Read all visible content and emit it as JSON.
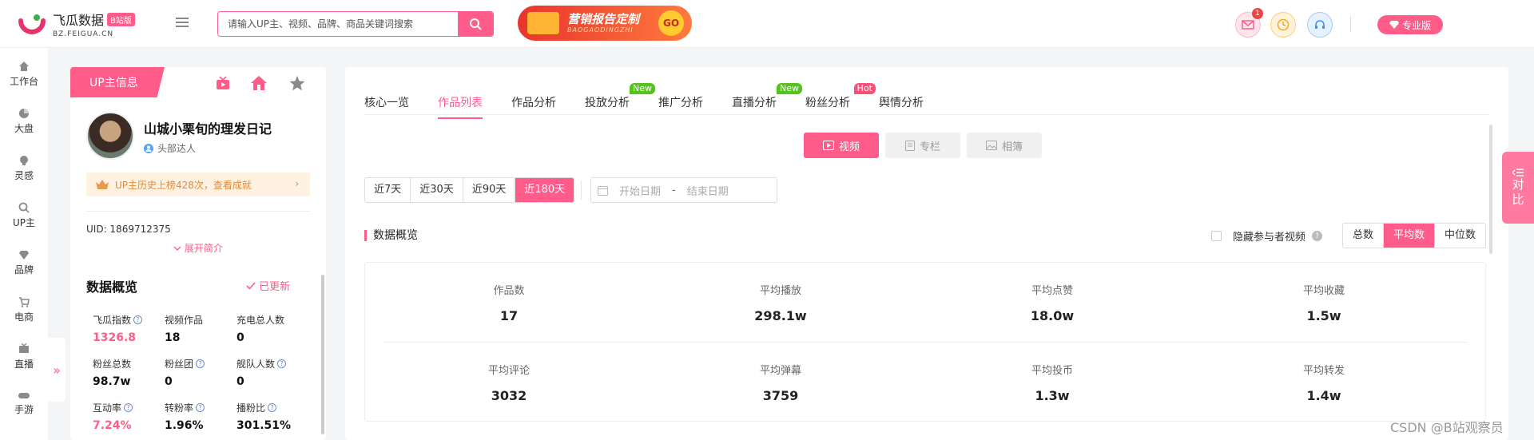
{
  "header": {
    "logo_name": "飞瓜数据",
    "logo_badge": "B站版",
    "logo_domain": "BZ.FEIGUA.CN",
    "search_placeholder": "请输入UP主、视频、品牌、商品关键词搜索",
    "promo_title": "营销报告定制",
    "promo_sub": "BAOGAODINGZHI",
    "promo_go": "GO",
    "message_count": "1",
    "pro_label": "专业版"
  },
  "leftnav": {
    "items": [
      {
        "label": "工作台",
        "icon": "home-icon"
      },
      {
        "label": "大盘",
        "icon": "pie-chart-icon"
      },
      {
        "label": "灵感",
        "icon": "bulb-icon"
      },
      {
        "label": "UP主",
        "icon": "search-icon"
      },
      {
        "label": "品牌",
        "icon": "diamond-icon"
      },
      {
        "label": "电商",
        "icon": "cart-icon"
      },
      {
        "label": "直播",
        "icon": "tv-icon"
      },
      {
        "label": "手游",
        "icon": "gamepad-icon"
      }
    ],
    "collapse": "»"
  },
  "profile": {
    "tab_label": "UP主信息",
    "name": "山城小栗旬的理发日记",
    "tag": "头部达人",
    "history": "UP主历史上榜428次，查看成就",
    "uid": "UID: 1869712375",
    "expand": "展开简介",
    "overview_title": "数据概览",
    "updated": "已更新",
    "stats": [
      {
        "label": "飞瓜指数",
        "value": "1326.8",
        "help": true,
        "pink": true
      },
      {
        "label": "视频作品",
        "value": "18",
        "help": false,
        "pink": false
      },
      {
        "label": "充电总人数",
        "value": "0",
        "help": false,
        "pink": false
      },
      {
        "label": "粉丝总数",
        "value": "98.7w",
        "help": false,
        "pink": false
      },
      {
        "label": "粉丝团",
        "value": "0",
        "help": true,
        "pink": false
      },
      {
        "label": "舰队人数",
        "value": "0",
        "help": true,
        "pink": false
      },
      {
        "label": "互动率",
        "value": "7.24%",
        "help": true,
        "pink": true
      },
      {
        "label": "转粉率",
        "value": "1.96%",
        "help": true,
        "pink": false
      },
      {
        "label": "播粉比",
        "value": "301.51%",
        "help": true,
        "pink": false
      }
    ]
  },
  "main": {
    "tabs": [
      {
        "label": "核心一览",
        "badge": ""
      },
      {
        "label": "作品列表",
        "badge": ""
      },
      {
        "label": "作品分析",
        "badge": ""
      },
      {
        "label": "投放分析",
        "badge": "New"
      },
      {
        "label": "推广分析",
        "badge": ""
      },
      {
        "label": "直播分析",
        "badge": "New"
      },
      {
        "label": "粉丝分析",
        "badge": "Hot"
      },
      {
        "label": "舆情分析",
        "badge": ""
      }
    ],
    "active_tab": "作品列表",
    "content_types": [
      "视频",
      "专栏",
      "相簿"
    ],
    "ranges": [
      "近7天",
      "近30天",
      "近90天",
      "近180天"
    ],
    "active_range": "近180天",
    "date_start": "开始日期",
    "date_sep": "-",
    "date_end": "结束日期",
    "section_title": "数据概览",
    "hide_participants": "隐藏参与者视频",
    "aggregates": [
      "总数",
      "平均数",
      "中位数"
    ],
    "active_aggregate": "平均数",
    "metrics": [
      {
        "label": "作品数",
        "value": "17"
      },
      {
        "label": "平均播放",
        "value": "298.1w"
      },
      {
        "label": "平均点赞",
        "value": "18.0w"
      },
      {
        "label": "平均收藏",
        "value": "1.5w"
      },
      {
        "label": "平均评论",
        "value": "3032"
      },
      {
        "label": "平均弹幕",
        "value": "3759"
      },
      {
        "label": "平均投币",
        "value": "1.3w"
      },
      {
        "label": "平均转发",
        "value": "1.4w"
      }
    ]
  },
  "compare": {
    "label_1": "对",
    "label_2": "比"
  },
  "watermark": "CSDN @B站观察员",
  "colors": {
    "brand": "#ff5c8a",
    "new_badge": "#52c41a",
    "hot_badge": "#ff4d7a"
  }
}
